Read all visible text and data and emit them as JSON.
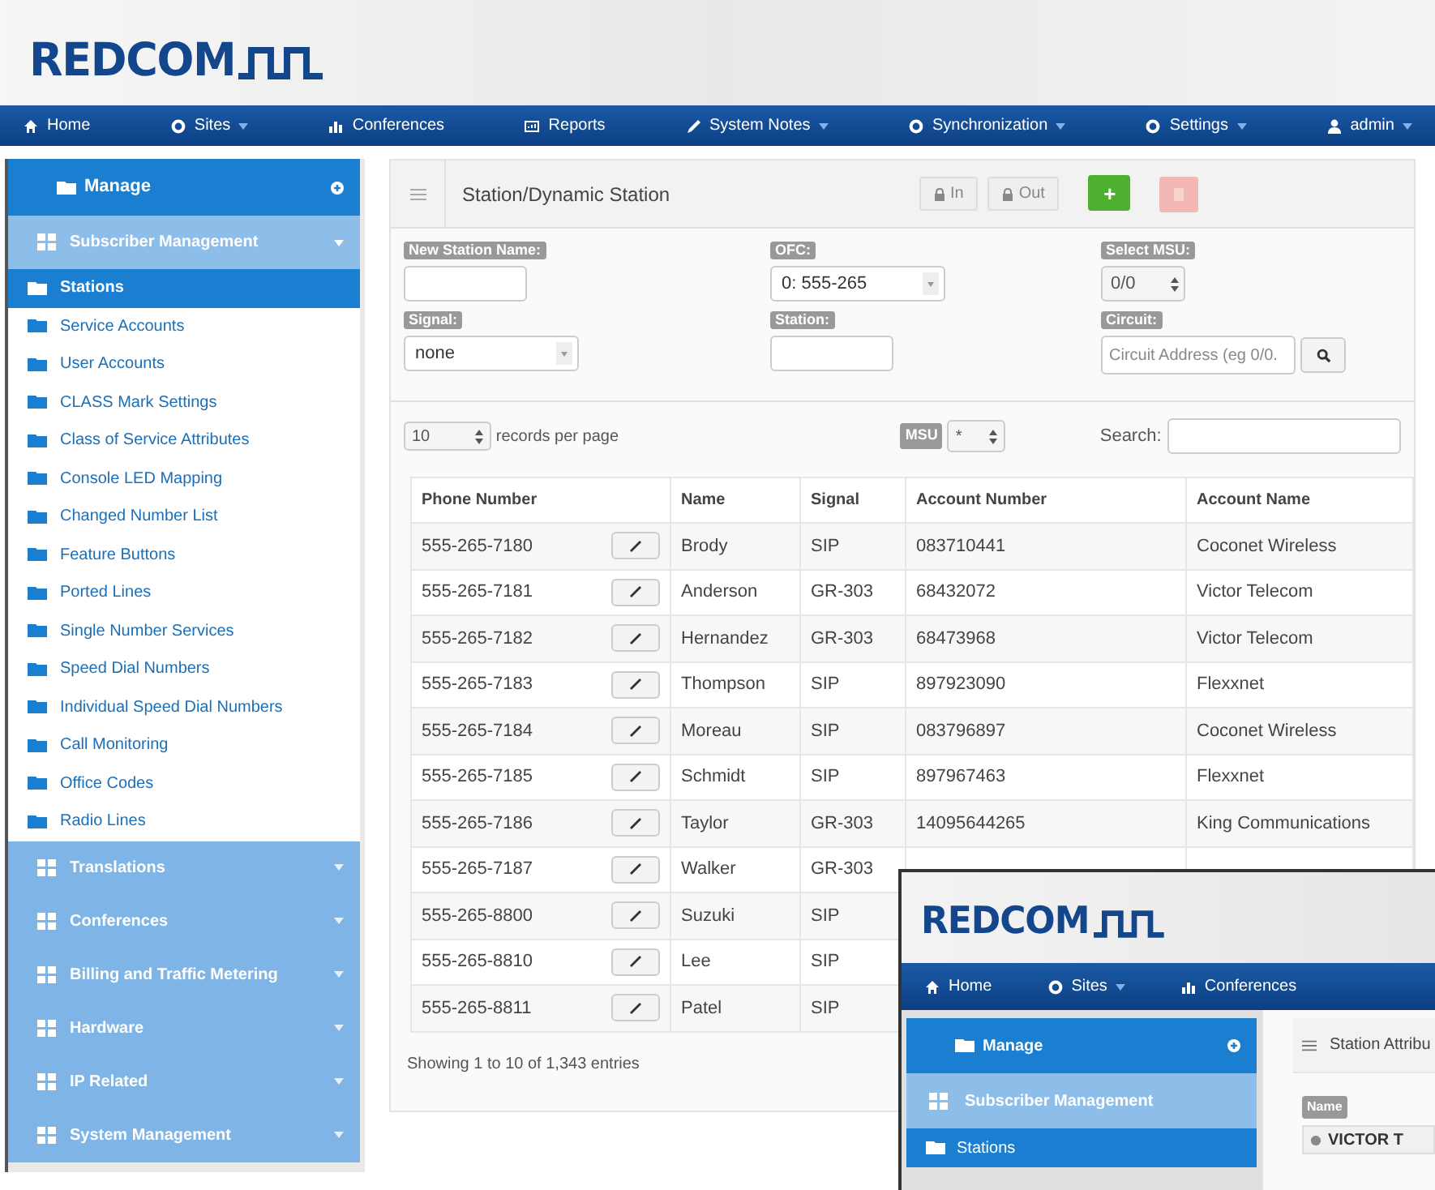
{
  "logo": {
    "text": "REDCOM"
  },
  "nav": [
    {
      "label": "Home",
      "dropdown": false
    },
    {
      "label": "Sites",
      "dropdown": true
    },
    {
      "label": "Conferences",
      "dropdown": false
    },
    {
      "label": "Reports",
      "dropdown": false
    },
    {
      "label": "System Notes",
      "dropdown": true
    },
    {
      "label": "Synchronization",
      "dropdown": true
    },
    {
      "label": "Settings",
      "dropdown": true
    },
    {
      "label": "admin",
      "dropdown": true
    }
  ],
  "sidebar": {
    "manage": "Manage",
    "groups": [
      {
        "label": "Subscriber Management",
        "expanded": true,
        "items": [
          {
            "label": "Stations",
            "selected": true
          },
          {
            "label": "Service Accounts",
            "selected": false
          },
          {
            "label": "User Accounts",
            "selected": false
          },
          {
            "label": "CLASS Mark Settings",
            "selected": false
          },
          {
            "label": "Class of Service Attributes",
            "selected": false
          },
          {
            "label": "Console LED Mapping",
            "selected": false
          },
          {
            "label": "Changed Number List",
            "selected": false
          },
          {
            "label": "Feature Buttons",
            "selected": false
          },
          {
            "label": "Ported Lines",
            "selected": false
          },
          {
            "label": "Single Number Services",
            "selected": false
          },
          {
            "label": "Speed Dial Numbers",
            "selected": false
          },
          {
            "label": "Individual Speed Dial Numbers",
            "selected": false
          },
          {
            "label": "Call Monitoring",
            "selected": false
          },
          {
            "label": "Office Codes",
            "selected": false
          },
          {
            "label": "Radio Lines",
            "selected": false
          }
        ]
      },
      {
        "label": "Translations",
        "expanded": false
      },
      {
        "label": "Conferences",
        "expanded": false
      },
      {
        "label": "Billing and Traffic Metering",
        "expanded": false
      },
      {
        "label": "Hardware",
        "expanded": false
      },
      {
        "label": "IP Related",
        "expanded": false
      },
      {
        "label": "System Management",
        "expanded": false
      }
    ]
  },
  "panel": {
    "title": "Station/Dynamic Station",
    "buttons": [
      {
        "kind": "lock",
        "label": "In",
        "disabled": false
      },
      {
        "kind": "lock",
        "label": "Out",
        "disabled": false
      },
      {
        "kind": "add",
        "label": "+",
        "disabled": false
      },
      {
        "kind": "delete",
        "disabled": true
      }
    ],
    "fields": [
      {
        "label": "New Station Name:",
        "kind": "text"
      },
      {
        "label": "OFC:",
        "kind": "select",
        "value": "0: 555-265"
      },
      {
        "label": "Select MSU:",
        "kind": "spinner",
        "value": "0/0"
      },
      {
        "label": "Signal:",
        "kind": "select",
        "value": "none"
      },
      {
        "label": "Station:",
        "kind": "text"
      },
      {
        "label": "Circuit:",
        "kind": "search",
        "placeholder": "Circuit Address (eg 0/0."
      }
    ],
    "page_size": "10",
    "page_size_label": "records per page",
    "msu_label": "MSU",
    "msu_value": "*",
    "search_label": "Search:",
    "table": {
      "columns": [
        "Phone Number",
        "Name",
        "Signal",
        "Account Number",
        "Account Name"
      ],
      "rows": [
        {
          "phone": "555-265-7180",
          "name": "Brody",
          "signal": "SIP",
          "account_number": "083710441",
          "account_name": "Coconet Wireless"
        },
        {
          "phone": "555-265-7181",
          "name": "Anderson",
          "signal": "GR-303",
          "account_number": "68432072",
          "account_name": "Victor Telecom"
        },
        {
          "phone": "555-265-7182",
          "name": "Hernandez",
          "signal": "GR-303",
          "account_number": "68473968",
          "account_name": "Victor Telecom"
        },
        {
          "phone": "555-265-7183",
          "name": "Thompson",
          "signal": "SIP",
          "account_number": "897923090",
          "account_name": "Flexxnet"
        },
        {
          "phone": "555-265-7184",
          "name": "Moreau",
          "signal": "SIP",
          "account_number": "083796897",
          "account_name": "Coconet Wireless"
        },
        {
          "phone": "555-265-7185",
          "name": "Schmidt",
          "signal": "SIP",
          "account_number": "897967463",
          "account_name": "Flexxnet"
        },
        {
          "phone": "555-265-7186",
          "name": "Taylor",
          "signal": "GR-303",
          "account_number": "14095644265",
          "account_name": "King Communications"
        },
        {
          "phone": "555-265-7187",
          "name": "Walker",
          "signal": "GR-303"
        },
        {
          "phone": "555-265-8800",
          "name": "Suzuki",
          "signal": "SIP"
        },
        {
          "phone": "555-265-8810",
          "name": "Lee",
          "signal": "SIP"
        },
        {
          "phone": "555-265-8811",
          "name": "Patel",
          "signal": "SIP"
        }
      ]
    },
    "footer": "Showing 1 to 10 of 1,343 entries"
  },
  "inset": {
    "logo": "REDCOM",
    "nav": [
      {
        "label": "Home",
        "dropdown": false
      },
      {
        "label": "Sites",
        "dropdown": true
      },
      {
        "label": "Conferences",
        "dropdown": false
      }
    ],
    "manage": "Manage",
    "group": "Subscriber Management",
    "item": "Stations",
    "panel_title": "Station Attribu",
    "field_label": "Name",
    "field_value": "VICTOR T"
  }
}
